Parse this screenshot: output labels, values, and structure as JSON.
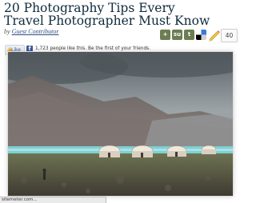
{
  "article": {
    "title": "20 Photography Tips Every Travel Photographer Must Know",
    "byline_prefix": "by",
    "author": "Guest Contributor"
  },
  "share": {
    "icons": [
      "plus-share-icon",
      "stumbleupon-icon",
      "tumblr-icon",
      "delicious-icon"
    ],
    "comment_count": "40",
    "colors": {
      "icon_bg": "#7a8a5a",
      "delicious_blue": "#3a7bd5"
    }
  },
  "facebook": {
    "like_label": "Like",
    "like_text": "1,723 people like this. Be the first of your friends.",
    "brand_color": "#3b5998"
  },
  "status_bar": {
    "text": "sitemeter.com..."
  }
}
